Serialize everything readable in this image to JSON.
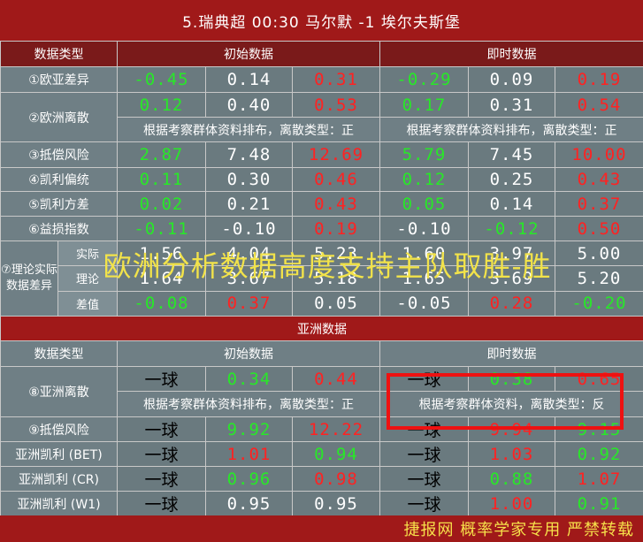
{
  "title": "5.瑞典超 00:30  马尔默 -1 埃尔夫斯堡",
  "header": {
    "type": "数据类型",
    "initial": "初始数据",
    "instant": "即时数据"
  },
  "eu_rows": [
    {
      "label": "①欧亚差异",
      "init": [
        "-0.45",
        "0.14",
        "0.31"
      ],
      "inst": [
        "-0.29",
        "0.09",
        "0.19"
      ]
    },
    {
      "label": "②欧洲离散",
      "init": [
        "0.12",
        "0.40",
        "0.53"
      ],
      "inst": [
        "0.17",
        "0.31",
        "0.54"
      ]
    },
    {
      "label": "③抵偿风险",
      "init": [
        "2.87",
        "7.48",
        "12.69"
      ],
      "inst": [
        "5.79",
        "7.45",
        "10.00"
      ]
    },
    {
      "label": "④凯利偏统",
      "init": [
        "0.11",
        "0.30",
        "0.46"
      ],
      "inst": [
        "0.12",
        "0.25",
        "0.43"
      ]
    },
    {
      "label": "⑤凯利方差",
      "init": [
        "0.02",
        "0.21",
        "0.43"
      ],
      "inst": [
        "0.05",
        "0.14",
        "0.37"
      ]
    },
    {
      "label": "⑥益损指数",
      "init": [
        "-0.11",
        "-0.10",
        "0.19"
      ],
      "inst": [
        "-0.10",
        "-0.12",
        "0.50"
      ]
    }
  ],
  "eu_note": "根据考察群体资料排布，离散类型：正",
  "theory": {
    "label": "⑦理论实际数据差异",
    "rows": [
      {
        "sub": "实际",
        "init": [
          "1.56",
          "4.04",
          "5.23"
        ],
        "inst": [
          "1.60",
          "3.97",
          "5.00"
        ]
      },
      {
        "sub": "理论",
        "init": [
          "1.64",
          "3.67",
          "5.18"
        ],
        "inst": [
          "1.65",
          "3.69",
          "5.20"
        ]
      },
      {
        "sub": "差值",
        "init": [
          "-0.08",
          "0.37",
          "0.05"
        ],
        "inst": [
          "-0.05",
          "0.28",
          "-0.20"
        ]
      }
    ]
  },
  "watermark": "欧洲分析数据高度支持主队取胜-胜",
  "asia": {
    "section": "亚洲数据",
    "header": {
      "type": "数据类型",
      "initial": "初始数据",
      "instant": "即时数据"
    },
    "disc": {
      "label": "⑧亚洲离散",
      "init": [
        "一球",
        "0.34",
        "0.44"
      ],
      "inst": [
        "一球",
        "0.38",
        "0.65"
      ],
      "note_init": "根据考察群体资料排布，离散类型：正",
      "note_inst": "根据考察群体资料，离散类型：反"
    },
    "rows": [
      {
        "label": "⑨抵偿风险",
        "init": [
          "一球",
          "9.92",
          "12.22"
        ],
        "inst": [
          "一球",
          "9.94",
          "9.15"
        ]
      },
      {
        "label": "亚洲凯利 (BET)",
        "init": [
          "一球",
          "1.01",
          "0.94"
        ],
        "inst": [
          "一球",
          "1.03",
          "0.92"
        ]
      },
      {
        "label": "亚洲凯利 (CR)",
        "init": [
          "一球",
          "0.96",
          "0.98"
        ],
        "inst": [
          "一球",
          "0.88",
          "1.07"
        ]
      },
      {
        "label": "亚洲凯利 (W1)",
        "init": [
          "一球",
          "0.95",
          "0.95"
        ],
        "inst": [
          "一球",
          "1.00",
          "0.91"
        ]
      }
    ]
  },
  "footer": "捷报网 概率学家专用 严禁转载"
}
